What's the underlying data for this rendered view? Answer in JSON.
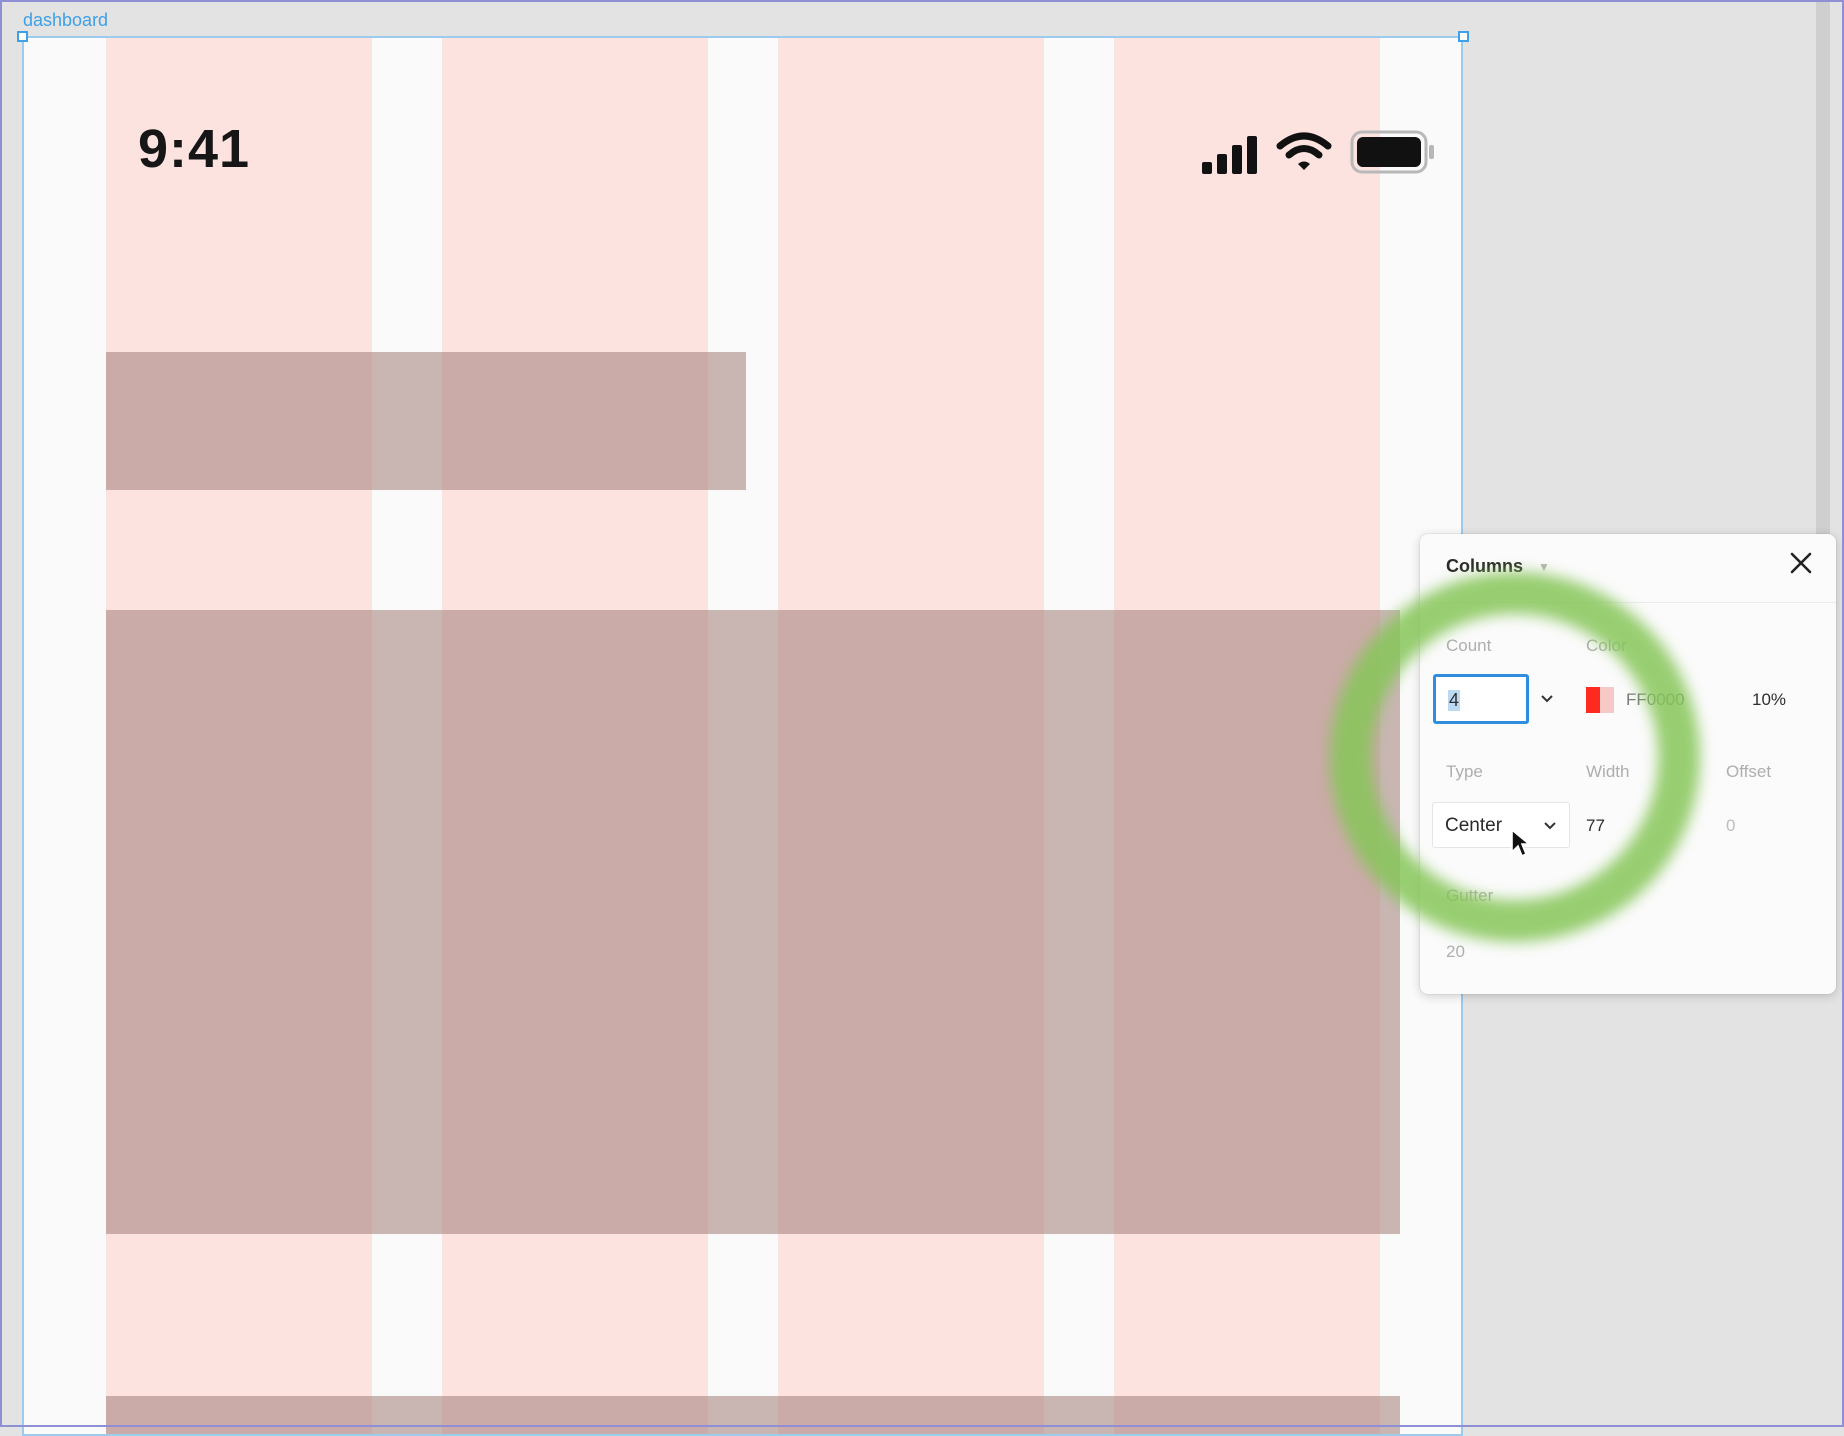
{
  "canvas": {
    "frame_label": "dashboard"
  },
  "status_bar": {
    "time": "9:41",
    "icons": [
      "cellular-signal-icon",
      "wifi-icon",
      "battery-icon"
    ]
  },
  "columns_panel": {
    "title": "Columns",
    "count_label": "Count",
    "count_value": "4",
    "color_label": "Color",
    "color_hex": "FF0000",
    "color_opacity": "10%",
    "type_label": "Type",
    "type_value": "Center",
    "width_label": "Width",
    "width_value": "77",
    "offset_label": "Offset",
    "offset_value": "0",
    "gutter_label": "Gutter",
    "gutter_value": "20"
  },
  "colors": {
    "grid_column": "#fde3df",
    "selection_blue": "#3ea0e6",
    "highlight_ring": "#86c658",
    "swatch_red": "#ff2a1f"
  }
}
